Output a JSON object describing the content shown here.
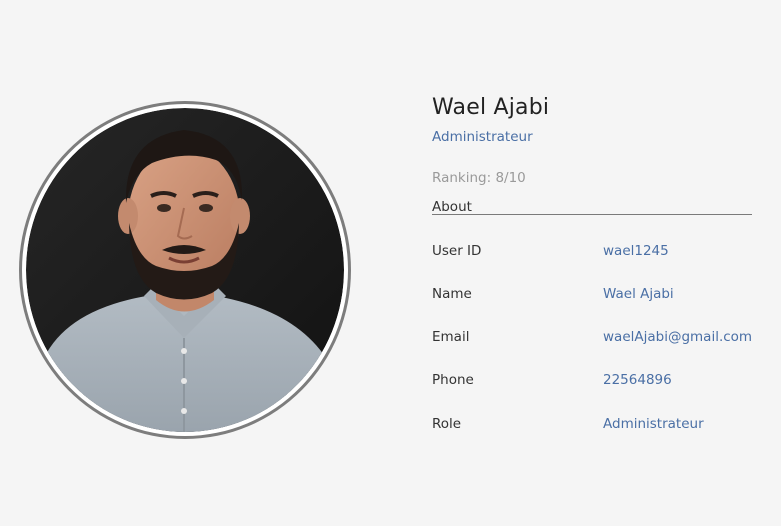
{
  "profile": {
    "name": "Wael Ajabi",
    "role": "Administrateur",
    "ranking": "Ranking: 8/10",
    "about_tab": "About"
  },
  "details": [
    {
      "label": "User ID",
      "value": "wael1245"
    },
    {
      "label": "Name",
      "value": "Wael Ajabi"
    },
    {
      "label": "Email",
      "value": "waelAjabi@gmail.com"
    },
    {
      "label": "Phone",
      "value": "22564896"
    },
    {
      "label": "Role",
      "value": "Administrateur"
    }
  ],
  "colors": {
    "background": "#f5f5f5",
    "accent": "#4a6fa5",
    "muted": "#9a9a9a",
    "avatar_border": "#7d7d7d"
  }
}
